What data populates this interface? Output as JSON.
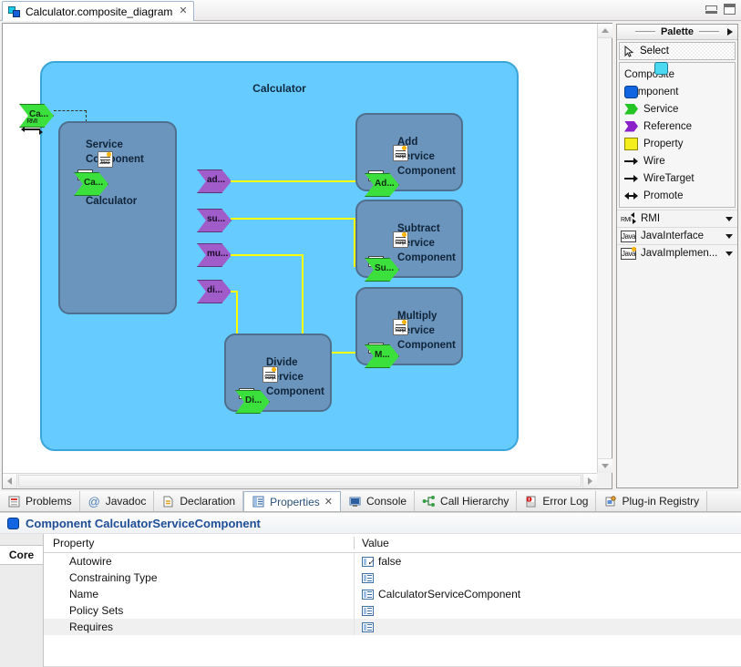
{
  "editor": {
    "tab_label": "Calculator.composite_diagram",
    "tab_close": "✕",
    "tab_icon": "composite-diagram-icon"
  },
  "window": {
    "minimize": "minimize-icon",
    "maximize": "maximize-icon"
  },
  "diagram": {
    "composite_title": "Calculator",
    "composite_color": "#66ccff",
    "component_color": "#6b95bd",
    "service_port_color": "#3ce03c",
    "reference_port_color": "#a05cc8",
    "wire_color": "#ffff00",
    "promoted_service": {
      "label": "Ca...",
      "binding": "RMI"
    },
    "components": [
      {
        "name_lines": [
          "Calculator",
          "Service",
          "Component"
        ],
        "service_port": "Ca...",
        "interface": "Java",
        "implementation": "Java",
        "references": [
          "ad...",
          "su...",
          "mu...",
          "di..."
        ]
      },
      {
        "name_lines": [
          "Add",
          "Service",
          "Component"
        ],
        "service_port": "Ad...",
        "interface": "Java",
        "implementation": "Script"
      },
      {
        "name_lines": [
          "Subtract",
          "Service",
          "Component"
        ],
        "service_port": "Su...",
        "interface": "Java",
        "implementation": "Script"
      },
      {
        "name_lines": [
          "Multiply",
          "Service",
          "Component"
        ],
        "service_port": "M...",
        "interface": "Java",
        "implementation": "Script"
      },
      {
        "name_lines": [
          "Divide",
          "Service",
          "Component"
        ],
        "service_port": "Di...",
        "interface": "Java",
        "implementation": "Script"
      }
    ]
  },
  "palette": {
    "title": "Palette",
    "collapse_icon": "chevron-right-icon",
    "select_label": "Select",
    "select_icon": "cursor-icon",
    "items": [
      {
        "label": "Composite",
        "icon": "composite-swatch-icon"
      },
      {
        "label": "Component",
        "icon": "component-swatch-icon"
      },
      {
        "label": "Service",
        "icon": "service-chevron-icon"
      },
      {
        "label": "Reference",
        "icon": "reference-chevron-icon"
      },
      {
        "label": "Property",
        "icon": "property-swatch-icon"
      },
      {
        "label": "Wire",
        "icon": "wire-arrow-icon"
      },
      {
        "label": "WireTarget",
        "icon": "wiretarget-arrow-icon"
      },
      {
        "label": "Promote",
        "icon": "promote-arrow-icon"
      }
    ],
    "drawers": [
      {
        "label": "RMI",
        "icon": "rmi-icon",
        "caret": "chevron-down-icon"
      },
      {
        "label": "JavaInterface",
        "icon": "java-interface-icon",
        "caret": "chevron-down-icon"
      },
      {
        "label": "JavaImplemen...",
        "icon": "java-implementation-icon",
        "caret": "chevron-down-icon"
      }
    ]
  },
  "bottom_views": {
    "tabs": [
      {
        "label": "Problems",
        "icon": "problems-icon",
        "active": false
      },
      {
        "label": "Javadoc",
        "icon": "javadoc-icon",
        "active": false
      },
      {
        "label": "Declaration",
        "icon": "declaration-icon",
        "active": false
      },
      {
        "label": "Properties",
        "icon": "properties-icon",
        "active": true,
        "close": "✕"
      },
      {
        "label": "Console",
        "icon": "console-icon",
        "active": false
      },
      {
        "label": "Call Hierarchy",
        "icon": "call-hierarchy-icon",
        "active": false
      },
      {
        "label": "Error Log",
        "icon": "error-log-icon",
        "active": false
      },
      {
        "label": "Plug-in Registry",
        "icon": "plugin-registry-icon",
        "active": false
      }
    ]
  },
  "properties": {
    "header_title": "Component CalculatorServiceComponent",
    "header_icon": "component-icon",
    "side_tabs": [
      "Core"
    ],
    "columns": [
      "Property",
      "Value"
    ],
    "rows": [
      {
        "property": "Autowire",
        "value": "false",
        "icon": "boolean-icon"
      },
      {
        "property": "Constraining Type",
        "value": "",
        "icon": "list-icon"
      },
      {
        "property": "Name",
        "value": "CalculatorServiceComponent",
        "icon": "list-icon"
      },
      {
        "property": "Policy Sets",
        "value": "",
        "icon": "list-icon"
      },
      {
        "property": "Requires",
        "value": "",
        "icon": "list-icon"
      }
    ]
  }
}
